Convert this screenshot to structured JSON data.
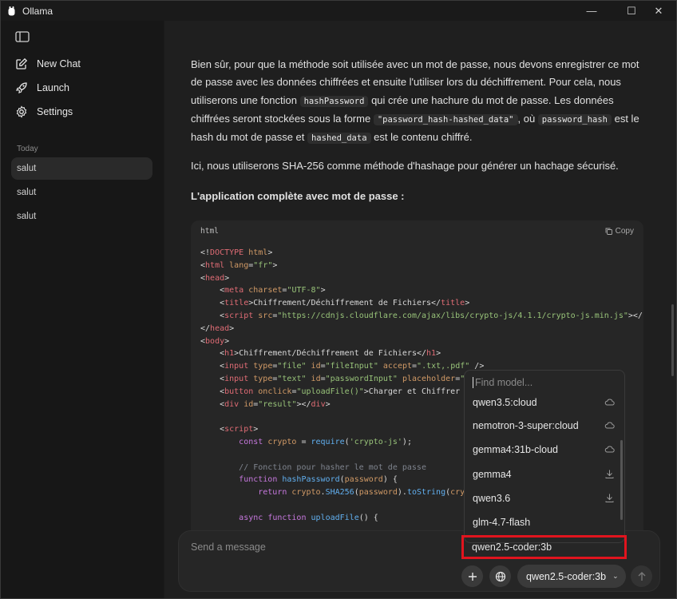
{
  "window": {
    "title": "Ollama",
    "minimize": "—",
    "maximize": "☐",
    "close": "✕"
  },
  "sidebar": {
    "nav": [
      {
        "label": "New Chat",
        "icon": "new-chat-icon"
      },
      {
        "label": "Launch",
        "icon": "rocket-icon"
      },
      {
        "label": "Settings",
        "icon": "gear-icon"
      }
    ],
    "section": "Today",
    "chats": [
      "salut",
      "salut",
      "salut"
    ]
  },
  "message": {
    "p1_a": "Bien sûr, pour que la méthode soit utilisée avec un mot de passe, nous devons enregistrer ce mot de passe avec les données chiffrées et ensuite l'utiliser lors du déchiffrement. Pour cela, nous utiliserons une fonction ",
    "p1_code1": "hashPassword",
    "p1_b": " qui crée une hachure du mot de passe. Les données chiffrées seront stockées sous la forme ",
    "p1_code2": "\"password_hash-hashed_data\"",
    "p1_c": ", où ",
    "p1_code3": "password_hash",
    "p1_d": " est le hash du mot de passe et ",
    "p1_code4": "hashed_data",
    "p1_e": " est le contenu chiffré.",
    "p2": "Ici, nous utiliserons SHA-256 comme méthode d'hashage pour générer un hachage sécurisé.",
    "p3": "L'application complète avec mot de passe :"
  },
  "codeblock": {
    "lang": "html",
    "copy_label": "Copy"
  },
  "composer": {
    "placeholder": "Send a message",
    "model": "qwen2.5-coder:3b"
  },
  "dropdown": {
    "placeholder": "Find model...",
    "items": [
      {
        "name": "qwen3.5:cloud",
        "icon": "cloud-icon"
      },
      {
        "name": "nemotron-3-super:cloud",
        "icon": "cloud-icon"
      },
      {
        "name": "gemma4:31b-cloud",
        "icon": "cloud-icon"
      },
      {
        "name": "gemma4",
        "icon": "download-icon"
      },
      {
        "name": "qwen3.6",
        "icon": "download-icon"
      },
      {
        "name": "glm-4.7-flash",
        "icon": ""
      },
      {
        "name": "qwen2.5-coder:3b",
        "icon": ""
      }
    ]
  },
  "colors": {
    "highlight": "#e0141e",
    "background": "#1f1f1f",
    "sidebar": "#171717"
  }
}
